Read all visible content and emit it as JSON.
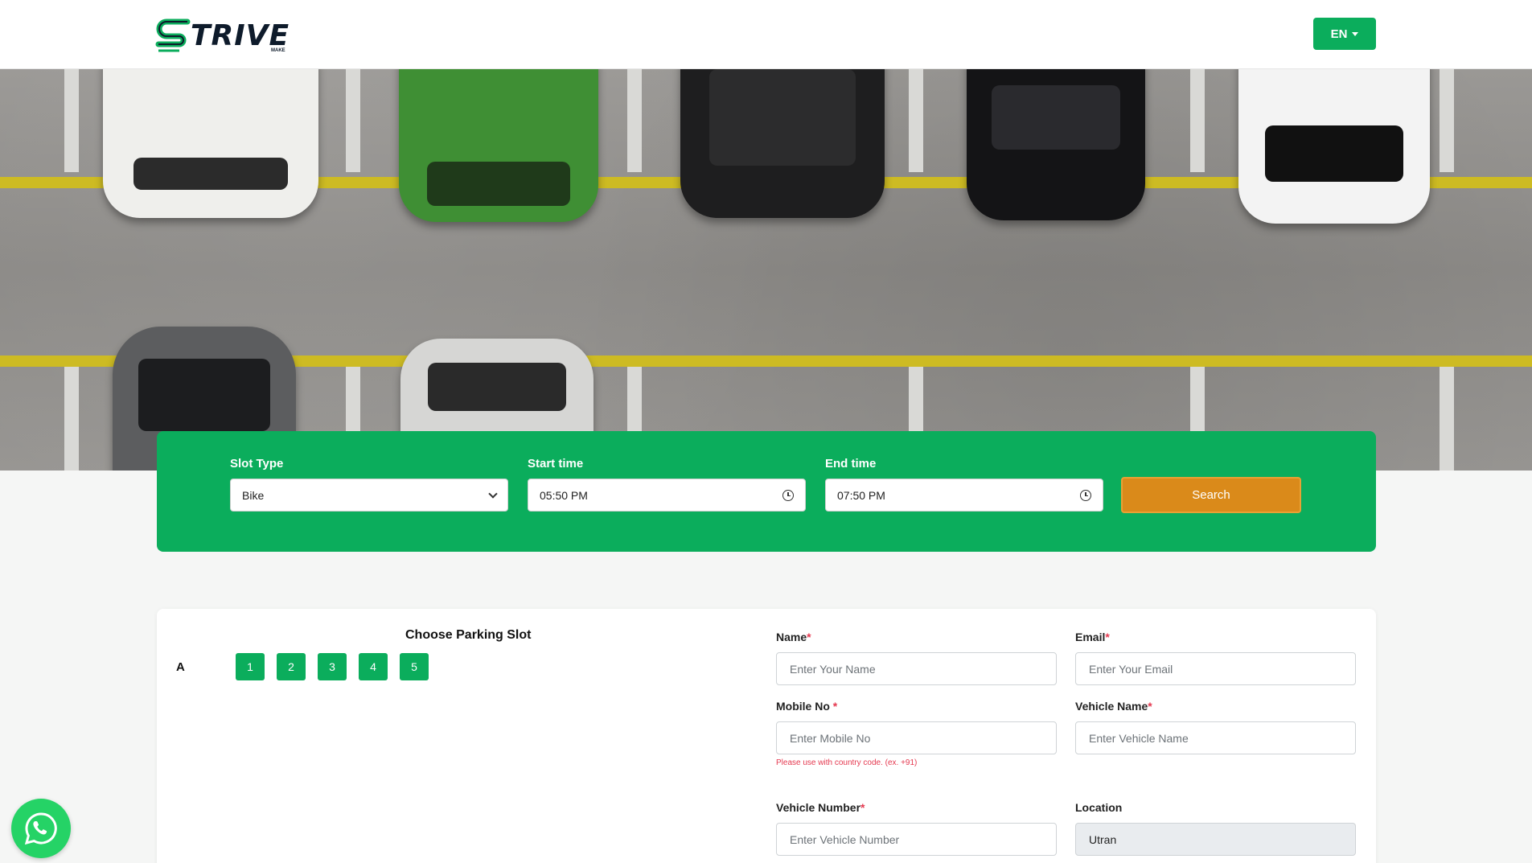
{
  "header": {
    "logo_text": "TRIVE",
    "logo_sub": "MAKE",
    "language": "EN"
  },
  "search": {
    "slot_type_label": "Slot Type",
    "slot_type_value": "Bike",
    "start_label": "Start time",
    "start_value": "05:50 PM",
    "end_label": "End time",
    "end_value": "07:50 PM",
    "button": "Search"
  },
  "slots": {
    "title": "Choose Parking Slot",
    "row": "A",
    "items": [
      "1",
      "2",
      "3",
      "4",
      "5"
    ]
  },
  "form": {
    "name_label": "Name",
    "name_placeholder": "Enter Your Name",
    "email_label": "Email",
    "email_placeholder": "Enter Your Email",
    "mobile_label": "Mobile No",
    "mobile_placeholder": "Enter Mobile No",
    "mobile_hint": "Please use with country code. (ex. +91)",
    "vehicle_name_label": "Vehicle Name",
    "vehicle_name_placeholder": "Enter Vehicle Name",
    "vehicle_number_label": "Vehicle Number",
    "vehicle_number_placeholder": "Enter Vehicle Number",
    "location_label": "Location",
    "location_value": "Utran",
    "required_mark": "*"
  },
  "colors": {
    "brand_green": "#0bad5c",
    "search_orange": "#da8a1a",
    "required_red": "#e53950"
  },
  "icons": [
    "strive-logo-icon",
    "caret-down-icon",
    "chevron-down-icon",
    "clock-icon",
    "whatsapp-icon"
  ]
}
